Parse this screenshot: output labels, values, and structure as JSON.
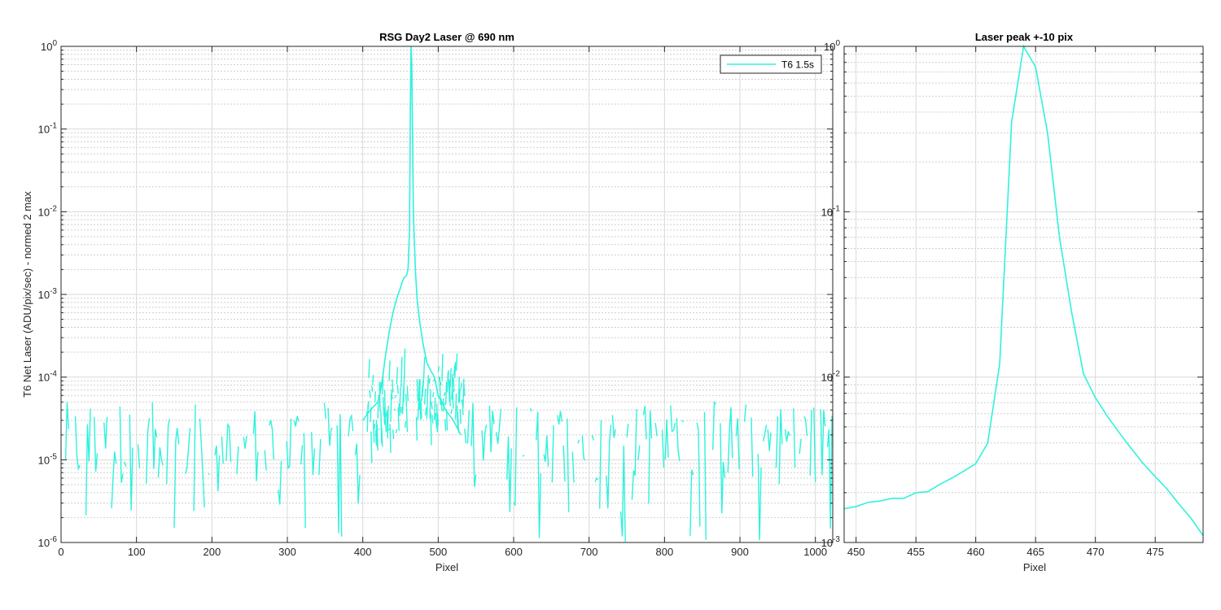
{
  "colors": {
    "series": "#2ef2dc",
    "grid": "#d9d9d9",
    "axis": "#262626"
  },
  "chart_data": [
    {
      "type": "line",
      "title": "RSG  Day2 Laser @ 690 nm",
      "xlabel": "Pixel",
      "ylabel": "T6 Net Laser (ADU/pix/sec) - normed 2 max",
      "xlim": [
        0,
        1023
      ],
      "ylim": [
        1e-06,
        1
      ],
      "yscale": "log",
      "grid": true,
      "legend_position": "top-right",
      "x_ticks": [
        "0",
        "100",
        "200",
        "300",
        "400",
        "500",
        "600",
        "700",
        "800",
        "900",
        "1000"
      ],
      "y_ticks": [
        {
          "base": "10",
          "exp": "-6"
        },
        {
          "base": "10",
          "exp": "-5"
        },
        {
          "base": "10",
          "exp": "-4"
        },
        {
          "base": "10",
          "exp": "-3"
        },
        {
          "base": "10",
          "exp": "-2"
        },
        {
          "base": "10",
          "exp": "-1"
        },
        {
          "base": "10",
          "exp": "0"
        }
      ],
      "series": [
        {
          "name": "T6 1.5s",
          "x": [
            400,
            410,
            420,
            425,
            430,
            435,
            440,
            445,
            450,
            452,
            455,
            458,
            460,
            462,
            463,
            464,
            465,
            466,
            467,
            468,
            470,
            472,
            475,
            480,
            485,
            490,
            495,
            500,
            510,
            520,
            530
          ],
          "y": [
            3e-05,
            4e-05,
            5e-05,
            8e-05,
            0.00018,
            0.00035,
            0.0006,
            0.0009,
            0.0012,
            0.0014,
            0.0016,
            0.0017,
            0.002,
            0.006,
            0.17,
            1.0,
            0.6,
            0.08,
            0.0105,
            0.0055,
            0.0018,
            0.0009,
            0.0005,
            0.00025,
            0.00015,
            0.00012,
            0.0001,
            6e-05,
            4e-05,
            3e-05,
            2e-05
          ]
        }
      ],
      "noise_floor": {
        "range": [
          0,
          1023
        ],
        "y_min": 1e-06,
        "y_typical": [
          5e-06,
          5e-05
        ]
      }
    },
    {
      "type": "line",
      "title": "Laser peak +-10 pix",
      "xlabel": "Pixel",
      "ylabel": "",
      "xlim": [
        449,
        479
      ],
      "ylim": [
        0.001,
        1
      ],
      "yscale": "log",
      "grid": true,
      "x_ticks": [
        "450",
        "455",
        "460",
        "465",
        "470",
        "475"
      ],
      "y_ticks": [
        {
          "base": "10",
          "exp": "-3"
        },
        {
          "base": "10",
          "exp": "-2"
        },
        {
          "base": "10",
          "exp": "-1"
        },
        {
          "base": "10",
          "exp": "0"
        }
      ],
      "series": [
        {
          "name": "T6 1.5s",
          "x": [
            449,
            450,
            451,
            452,
            453,
            454,
            455,
            456,
            457,
            458,
            459,
            460,
            461,
            462,
            463,
            464,
            465,
            466,
            467,
            468,
            469,
            470,
            471,
            472,
            473,
            474,
            475,
            476,
            477,
            478,
            479
          ],
          "y": [
            0.0016,
            0.00165,
            0.00175,
            0.00178,
            0.00185,
            0.00185,
            0.002,
            0.00203,
            0.00225,
            0.00245,
            0.0027,
            0.003,
            0.004,
            0.012,
            0.35,
            1.0,
            0.75,
            0.3,
            0.07,
            0.025,
            0.0105,
            0.0075,
            0.0058,
            0.0046,
            0.0037,
            0.003,
            0.0025,
            0.0021,
            0.0017,
            0.0014,
            0.0011
          ]
        }
      ]
    }
  ]
}
